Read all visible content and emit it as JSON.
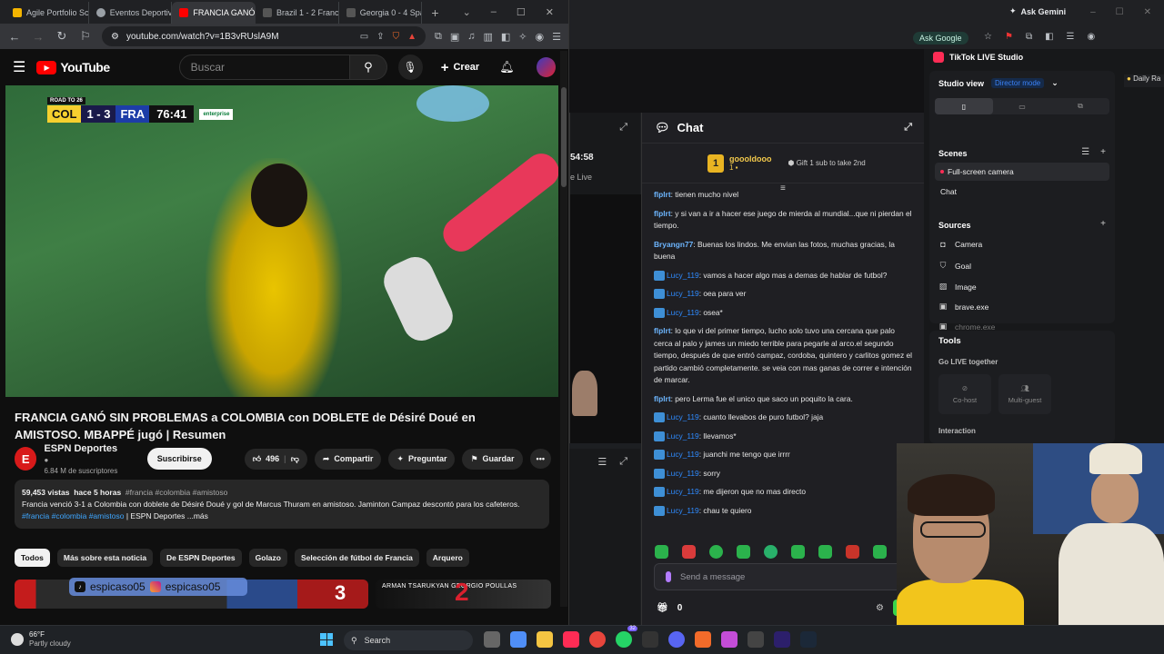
{
  "left_browser": {
    "tabs": [
      {
        "label": "Agile Portfolio Sc",
        "color": "#f4b400"
      },
      {
        "label": "Eventos Deportiv",
        "color": "#9aa0a6"
      },
      {
        "label": "FRANCIA GANÓ",
        "color": "#ff0000",
        "active": true
      },
      {
        "label": "Brazil 1 - 2 Franc",
        "color": "#555"
      },
      {
        "label": "Georgia 0 - 4 Spa",
        "color": "#555"
      }
    ],
    "url": "youtube.com/watch?v=1B3vRUslA9M"
  },
  "youtube": {
    "logo_text": "YouTube",
    "search_placeholder": "Buscar",
    "create_label": "Crear",
    "scoreboard": {
      "event": "ROAD TO 26",
      "home": "COL",
      "score": "1 - 3",
      "away": "FRA",
      "clock": "76:41",
      "sponsor": "enterprise"
    },
    "title": "FRANCIA GANÓ SIN PROBLEMAS a COLOMBIA con DOBLETE de Désiré Doué en AMISTOSO. MBAPPÉ jugó | Resumen",
    "channel": {
      "name": "ESPN Deportes",
      "initial": "E",
      "subscribers": "6.84 M de suscriptores",
      "subscribe_label": "Suscribirse"
    },
    "actions": {
      "likes": "496",
      "share": "Compartir",
      "ask": "Preguntar",
      "save": "Guardar"
    },
    "description": {
      "views": "59,453 vistas",
      "age": "hace 5 horas",
      "hashtags_top": "#francia #colombia #amistoso",
      "text": "Francia venció 3-1 a Colombia con doblete de Désiré Doué y gol de Marcus Thuram en amistoso. Jaminton Campaz descontó para los cafeteros.",
      "hashtags_bottom": "#francia #colombia #amistoso",
      "suffix": "| ESPN Deportes ...más"
    },
    "chips": [
      "Todos",
      "Más sobre esta noticia",
      "De ESPN Deportes",
      "Golazo",
      "Selección de fútbol de Francia",
      "Arquero"
    ],
    "overlay": {
      "tiktok": "espicaso05",
      "instagram": "espicaso05"
    },
    "thumb_texts": {
      "number": "3",
      "names": "ARMAN TSARUKYAN  GEORGIO POULLAS",
      "big": "2"
    }
  },
  "middle_panel": {
    "time": "54:58",
    "live": "e Live"
  },
  "chat": {
    "title": "Chat",
    "top_gifter": {
      "rank": "1",
      "name": "goooldooo",
      "subs": "1",
      "gift_text": "Gift 1 sub to take 2nd"
    },
    "messages": [
      {
        "user": "flplrt",
        "text": ": tienen mucho nivel",
        "style": "bold"
      },
      {
        "user": "flplrt",
        "text": ": y si van a ir a hacer ese juego de mierda al mundial...que ni pierdan el tiempo.",
        "style": "bold"
      },
      {
        "user": "Bryangn77",
        "text": ": Buenas los lindos. Me envian las fotos, muchas gracias, la buena",
        "style": "bold"
      },
      {
        "user": "Lucy_119",
        "text": ": vamos a hacer algo mas a demas de hablar de futbol?",
        "style": "badge"
      },
      {
        "user": "Lucy_119",
        "text": ": oea para ver",
        "style": "badge"
      },
      {
        "user": "Lucy_119",
        "text": ": osea*",
        "style": "badge"
      },
      {
        "user": "flplrt",
        "text": ": lo que vi del primer tiempo, lucho solo tuvo una cercana que palo cerca al palo y james un miedo terrible para pegarle al arco.el segundo tiempo, después de que entró campaz, cordoba, quintero y carlitos gomez el partido cambió completamente. se veia con mas ganas de correr e intención de marcar.",
        "style": "bold"
      },
      {
        "user": "flplrt",
        "text": ": pero Lerma fue el unico que saco un poquito la cara.",
        "style": "bold"
      },
      {
        "user": "Lucy_119",
        "text": ": cuanto llevabos de puro futbol? jaja",
        "style": "badge"
      },
      {
        "user": "Lucy_119",
        "text": ": llevamos*",
        "style": "badge"
      },
      {
        "user": "Lucy_119",
        "text": ": juanchi me tengo que irrrr",
        "style": "badge"
      },
      {
        "user": "Lucy_119",
        "text": ": sorry",
        "style": "badge"
      },
      {
        "user": "Lucy_119",
        "text": ": me dijeron que no mas directo",
        "style": "badge"
      },
      {
        "user": "Lucy_119",
        "text": ": chau te quiero",
        "style": "badge"
      }
    ],
    "send_placeholder": "Send a message",
    "points": "0",
    "chat_button": "Ch"
  },
  "right_browser": {
    "ask_gemini": "Ask Gemini",
    "ask_google": "Ask Google"
  },
  "studio": {
    "title": "TikTok LIVE Studio",
    "daily": "Daily Ra",
    "view_label": "Studio view",
    "mode": "Director mode",
    "scenes_label": "Scenes",
    "scenes": [
      "Full-screen camera",
      "Chat"
    ],
    "sources_label": "Sources",
    "sources": [
      "Camera",
      "Goal",
      "Image",
      "brave.exe",
      "chrome.exe"
    ],
    "tools_label": "Tools",
    "go_live_together": "Go LIVE together",
    "cohost": "Co-host",
    "multiguest": "Multi-guest",
    "interaction": "Interaction"
  },
  "taskbar": {
    "temperature": "66°F",
    "condition": "Partly cloudy",
    "search": "Search",
    "badge": "32"
  }
}
